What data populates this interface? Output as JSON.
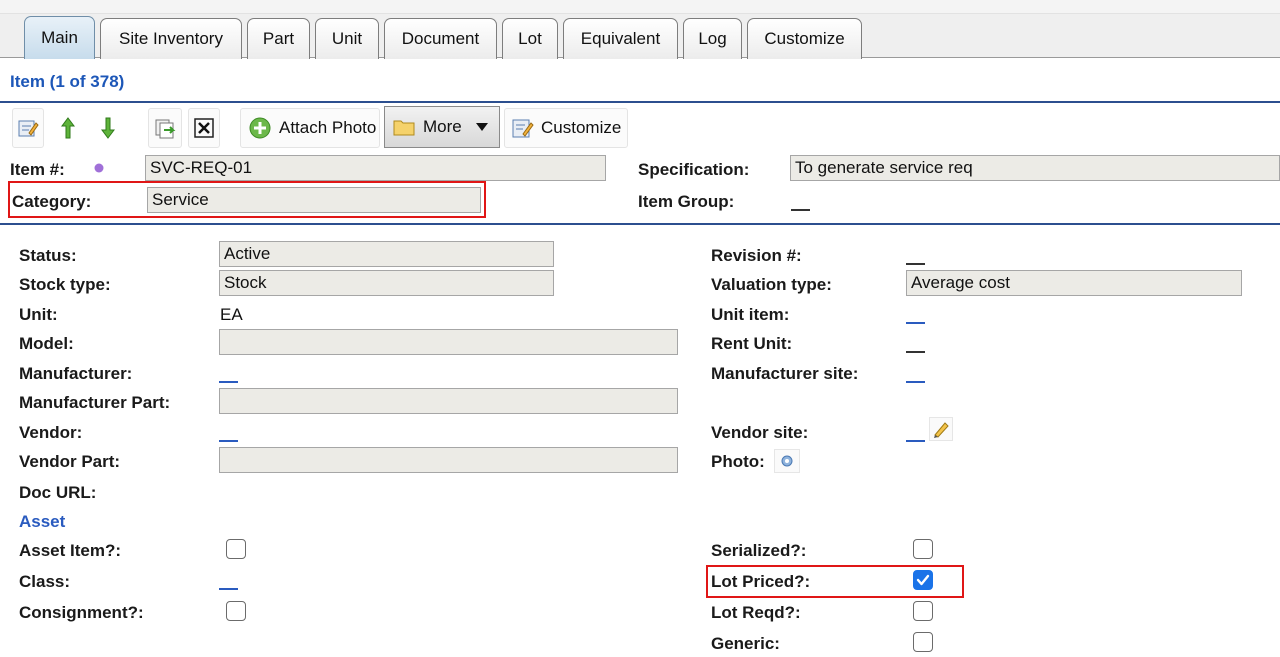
{
  "tabs": [
    "Main",
    "Site Inventory",
    "Part",
    "Unit",
    "Document",
    "Lot",
    "Equivalent",
    "Log",
    "Customize"
  ],
  "header": {
    "title": "Item (1 of 378)"
  },
  "toolbar": {
    "edit_icon": "edit-form-icon",
    "up_icon": "arrow-up-icon",
    "down_icon": "arrow-down-icon",
    "copy_icon": "copy-icon",
    "delete_icon": "delete-icon",
    "attach_photo_label": "Attach Photo",
    "more_label": "More",
    "customize_label": "Customize"
  },
  "top_form": {
    "item_label": "Item #:",
    "item_value": "SVC-REQ-01",
    "category_label": "Category:",
    "category_value": "Service",
    "spec_label": "Specification:",
    "spec_value": "To generate service req",
    "group_label": "Item Group:"
  },
  "left_fields": {
    "status_label": "Status:",
    "status_value": "Active",
    "stock_label": "Stock type:",
    "stock_value": "Stock",
    "unit_label": "Unit:",
    "unit_value": "EA",
    "model_label": "Model:",
    "model_value": "",
    "manufacturer_label": "Manufacturer:",
    "mfr_part_label": "Manufacturer Part:",
    "mfr_part_value": "",
    "vendor_label": "Vendor:",
    "vendor_part_label": "Vendor Part:",
    "vendor_part_value": "",
    "doc_url_label": "Doc URL:",
    "asset_section": "Asset",
    "asset_item_label": "Asset Item?:",
    "class_label": "Class:",
    "consignment_label": "Consignment?:"
  },
  "right_fields": {
    "revision_label": "Revision #:",
    "valuation_label": "Valuation type:",
    "valuation_value": "Average cost",
    "unit_item_label": "Unit item:",
    "rent_unit_label": "Rent Unit:",
    "mfr_site_label": "Manufacturer site:",
    "vendor_site_label": "Vendor site:",
    "photo_label": "Photo:",
    "serialized_label": "Serialized?:",
    "lot_priced_label": "Lot Priced?:",
    "lot_reqd_label": "Lot Reqd?:",
    "generic_label": "Generic:"
  },
  "checkboxes": {
    "asset_item": false,
    "consignment": false,
    "serialized": false,
    "lot_priced": true,
    "lot_reqd": false,
    "generic": false
  },
  "colors": {
    "link_blue": "#2a5bbf",
    "header_blue": "#1d57b8",
    "highlight_red": "#e01616",
    "check_blue": "#1a73e8"
  }
}
